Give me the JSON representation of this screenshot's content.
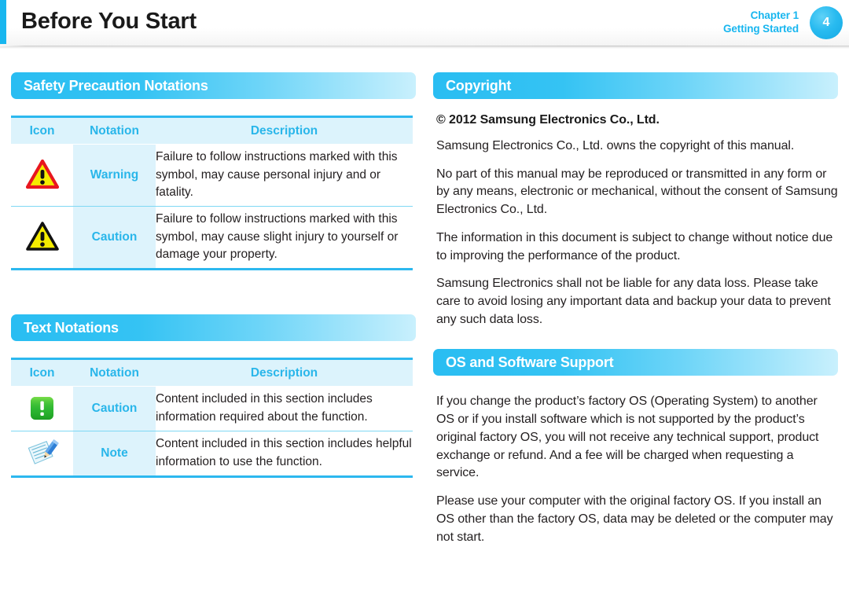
{
  "header": {
    "title": "Before You Start",
    "chapter_line1": "Chapter 1",
    "chapter_line2": "Getting Started",
    "page_number": "4",
    "accent_color": "#18b6ef"
  },
  "left_column": {
    "safety_section": {
      "title": "Safety Precaution Notations",
      "table": {
        "columns": [
          "Icon",
          "Notation",
          "Description"
        ],
        "rows": [
          {
            "icon": "warning-triangle-icon",
            "notation": "Warning",
            "description": "Failure to follow instructions marked with this symbol, may cause personal injury and or fatality."
          },
          {
            "icon": "caution-triangle-icon",
            "notation": "Caution",
            "description": "Failure to follow instructions marked with this symbol, may cause slight injury to yourself or damage your property."
          }
        ]
      }
    },
    "text_section": {
      "title": "Text Notations",
      "table": {
        "columns": [
          "Icon",
          "Notation",
          "Description"
        ],
        "rows": [
          {
            "icon": "green-exclamation-icon",
            "notation": "Caution",
            "description": "Content included in this section includes information required about the function."
          },
          {
            "icon": "note-pencil-icon",
            "notation": "Note",
            "description": "Content included in this section includes helpful information to use the function."
          }
        ]
      }
    }
  },
  "right_column": {
    "copyright_section": {
      "title": "Copyright",
      "notice": "© 2012 Samsung Electronics Co., Ltd.",
      "paragraphs": [
        "Samsung Electronics Co., Ltd. owns the copyright of this manual.",
        "No part of this manual may be reproduced or transmitted in any form or by any means, electronic or mechanical, without the consent of Samsung Electronics Co., Ltd.",
        "The information in this document is subject to change without notice due to improving the performance of the product.",
        "Samsung Electronics shall not be liable for any data loss. Please take care to avoid losing any important data and backup your data to prevent any such data loss."
      ]
    },
    "os_section": {
      "title": "OS and Software Support",
      "paragraphs": [
        "If you change the product’s factory OS (Operating System) to another OS or if you install software which is not supported by the product’s original factory OS, you will not receive any technical support, product exchange or refund. And a fee will be charged when requesting a service.",
        "Please use your computer with the original factory OS. If you install an OS other than the factory OS, data may be deleted or the computer may not start."
      ]
    }
  }
}
